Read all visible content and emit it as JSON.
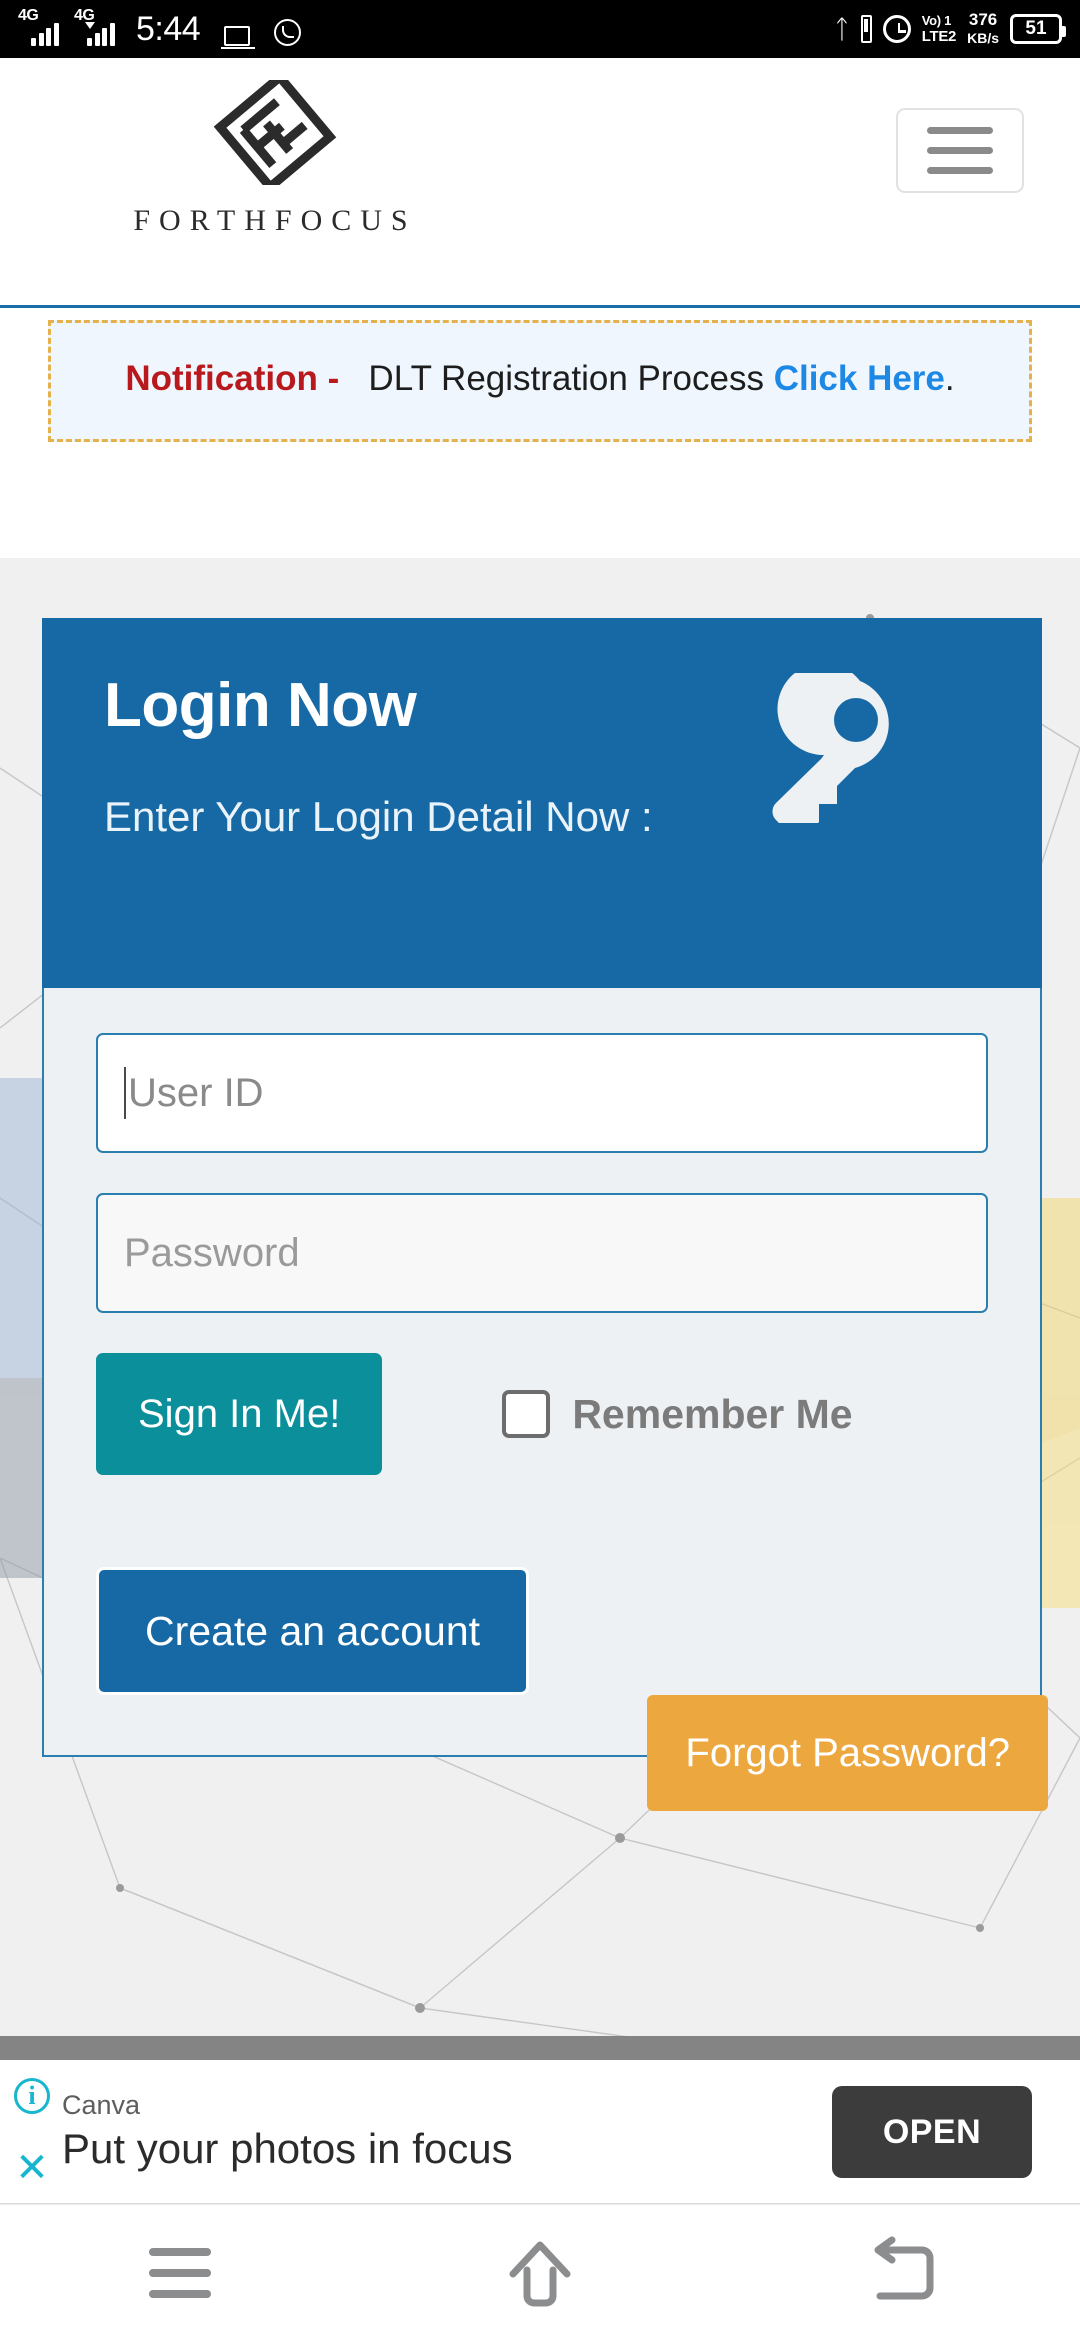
{
  "statusbar": {
    "network_left": "4G",
    "network_right": "4G",
    "time": "5:44",
    "icons": [
      "laptop-cast-icon",
      "whatsapp-icon",
      "bluetooth-icon",
      "sim-icon",
      "alarm-icon"
    ],
    "volte_line1": "Vo) 1",
    "volte_line2": "LTE2",
    "data_rate_value": "376",
    "data_rate_unit": "KB/s",
    "battery_percent": "51"
  },
  "header": {
    "brand_wordmark": "FORTHFOCUS",
    "logo_alt": "forthfocus-logo",
    "menu_label": "hamburger-menu"
  },
  "notification": {
    "label": "Notification -",
    "message": "DLT Registration Process",
    "link_text": "Click Here",
    "period": ".",
    "label_color": "#b9191c",
    "link_color": "#1e88e5",
    "border_color": "#e5b14b",
    "background_color": "#eff6fd"
  },
  "login": {
    "title": "Login Now",
    "subtitle": "Enter Your Login Detail Now :",
    "header_color": "#1769a6",
    "key_icon": "key-icon",
    "userid_placeholder": "User ID",
    "userid_value": "",
    "password_placeholder": "Password",
    "password_value": "",
    "signin_label": "Sign In Me!",
    "signin_color": "#0a8f9b",
    "remember_label": "Remember Me",
    "remember_checked": false,
    "create_label": "Create an account",
    "create_color": "#1769a6",
    "forgot_label": "Forgot Password?",
    "forgot_color": "#eda73f"
  },
  "ad": {
    "brand": "Canva",
    "headline": "Put your photos in focus",
    "cta": "OPEN",
    "info_glyph": "i",
    "close_glyph": "✕"
  },
  "navbar": {
    "recents": "recents-icon",
    "home": "home-icon",
    "back": "back-icon"
  }
}
